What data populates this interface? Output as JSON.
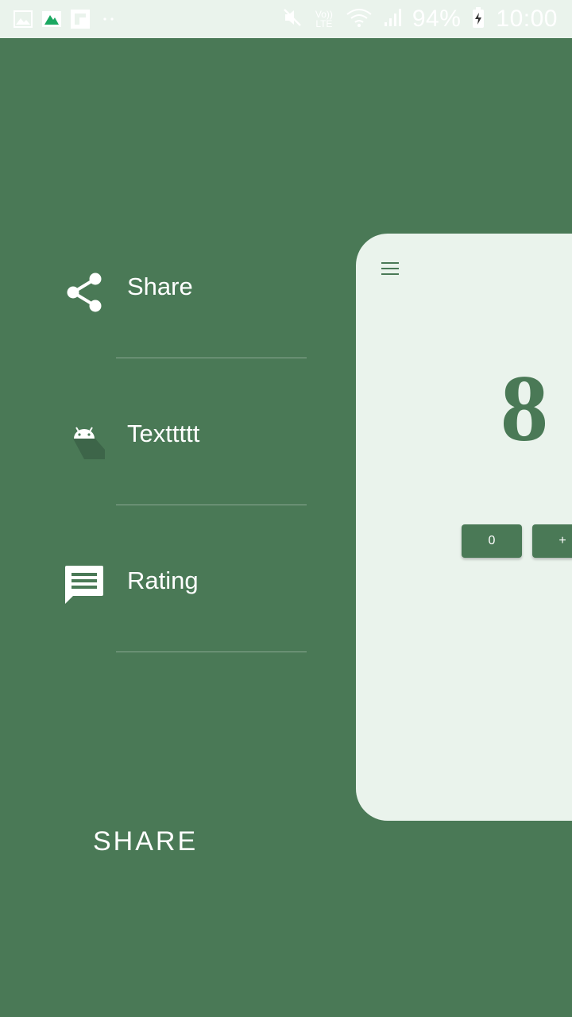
{
  "status_bar": {
    "battery": "94%",
    "time": "10:00",
    "network": "Vo)) LTE",
    "icons": [
      "image-icon",
      "app-icon",
      "flipboard-icon",
      "mute-icon",
      "wifi-icon",
      "signal-icon",
      "battery-icon"
    ]
  },
  "drawer": {
    "items": [
      {
        "label": "Share",
        "icon": "share-icon"
      },
      {
        "label": "Texttttt",
        "icon": "android-icon"
      },
      {
        "label": "Rating",
        "icon": "message-icon"
      }
    ],
    "cta_label": "SHARE"
  },
  "main": {
    "counter": "8",
    "buttons": {
      "reset_label": "0",
      "increment_label": "+"
    }
  },
  "colors": {
    "primary": "#4a7956",
    "surface": "#eaf3ec"
  }
}
